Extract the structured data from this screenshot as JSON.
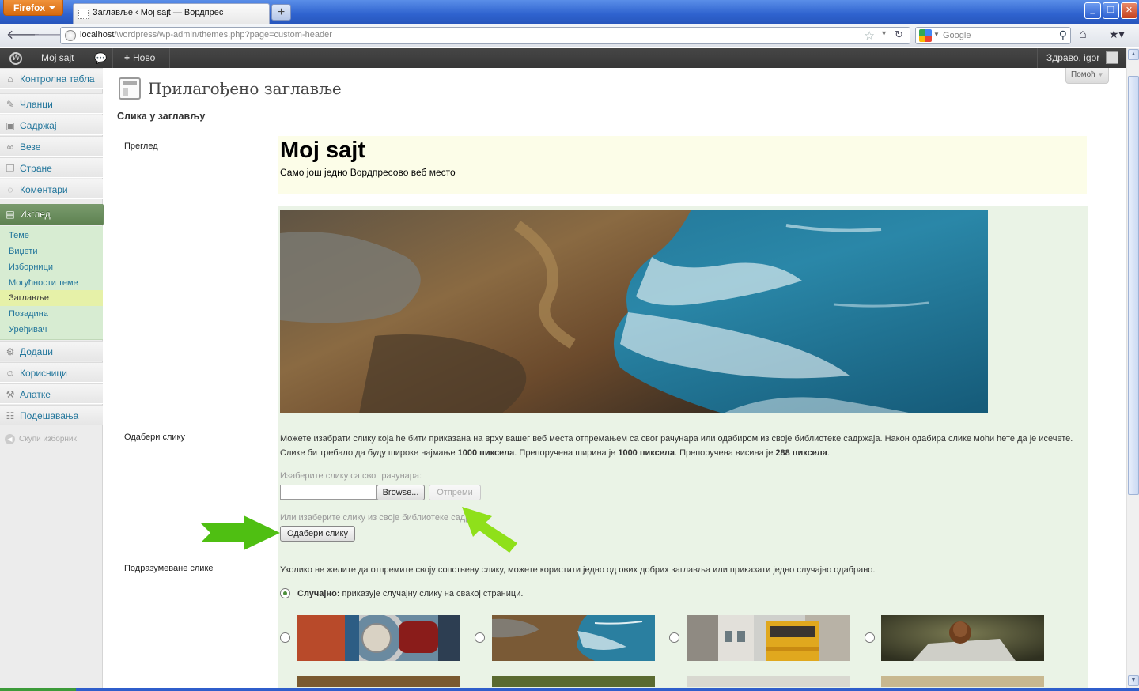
{
  "browser": {
    "menu_button": "Firefox",
    "tab_title": "Заглавље ‹ Мој sajt — Вордпрес",
    "new_tab": "+",
    "url_host": "localhost",
    "url_path": "/wordpress/wp-admin/themes.php?page=custom-header",
    "search_placeholder": "Google",
    "window_buttons": {
      "minimize": "_",
      "maximize": "❐",
      "close": "✕"
    }
  },
  "adminbar": {
    "wp_logo": "W",
    "site_name": "Мој sajt",
    "comments_icon": "speech-bubble-icon",
    "new_label": "Ново",
    "greeting": "Здраво, igor"
  },
  "sidebar": {
    "menu": [
      {
        "label": "Контролна табла",
        "icon": "home-icon"
      },
      {
        "label": "Чланци",
        "icon": "pin-icon"
      },
      {
        "label": "Садржај",
        "icon": "media-icon"
      },
      {
        "label": "Везе",
        "icon": "link-icon"
      },
      {
        "label": "Стране",
        "icon": "page-icon"
      },
      {
        "label": "Коментари",
        "icon": "comment-icon"
      },
      {
        "label": "Изглед",
        "icon": "appearance-icon"
      },
      {
        "label": "Додаци",
        "icon": "plugin-icon"
      },
      {
        "label": "Корисници",
        "icon": "users-icon"
      },
      {
        "label": "Алатке",
        "icon": "tools-icon"
      },
      {
        "label": "Подешавања",
        "icon": "settings-icon"
      }
    ],
    "submenu": [
      {
        "label": "Теме"
      },
      {
        "label": "Виџети"
      },
      {
        "label": "Изборници"
      },
      {
        "label": "Могућности теме"
      },
      {
        "label": "Заглавље"
      },
      {
        "label": "Позадина"
      },
      {
        "label": "Уређивач"
      }
    ],
    "collapse_label": "Скупи изборник"
  },
  "main": {
    "help_label": "Помоћ",
    "page_title": "Прилагођено заглавље",
    "section_title": "Слика у заглављу",
    "labels": {
      "preview": "Преглед",
      "choose": "Одабери слику",
      "defaults": "Подразумеване слике"
    },
    "preview": {
      "site_name": "Мој sajt",
      "tagline": "Само још једно Вордпресово веб место"
    },
    "upload": {
      "desc_line1": "Можете изабрати слику која ће бити приказана на врху вашег веб места отпремањем са свог рачунара или одабиром из своје библиотеке садржаја. Након одабира слике моћи ћете да је исечете.",
      "desc_line2_a": "Слике би требало да буду широке најмање ",
      "desc_line2_b": "1000 пиксела",
      "desc_line2_c": ". Препоручена ширина је ",
      "desc_line2_d": "1000 пиксела",
      "desc_line2_e": ". Препоручена висина је ",
      "desc_line2_f": "288 пиксела",
      "desc_line2_g": ".",
      "from_computer": "Изаберите слику са свог рачунара:",
      "browse_label": "Browse...",
      "upload_label": "Отпреми",
      "from_library": "Или изаберите слику из своје библиотеке садржаја:",
      "choose_button": "Одабери слику"
    },
    "defaults": {
      "intro": "Уколико не желите да отпремите своју сопствену слику, можете користити једно од ових добрих заглавља или приказати једно случајно одабрано.",
      "random_label": "Случајно:",
      "random_desc": " приказује случајну слику на свакој страници."
    }
  }
}
